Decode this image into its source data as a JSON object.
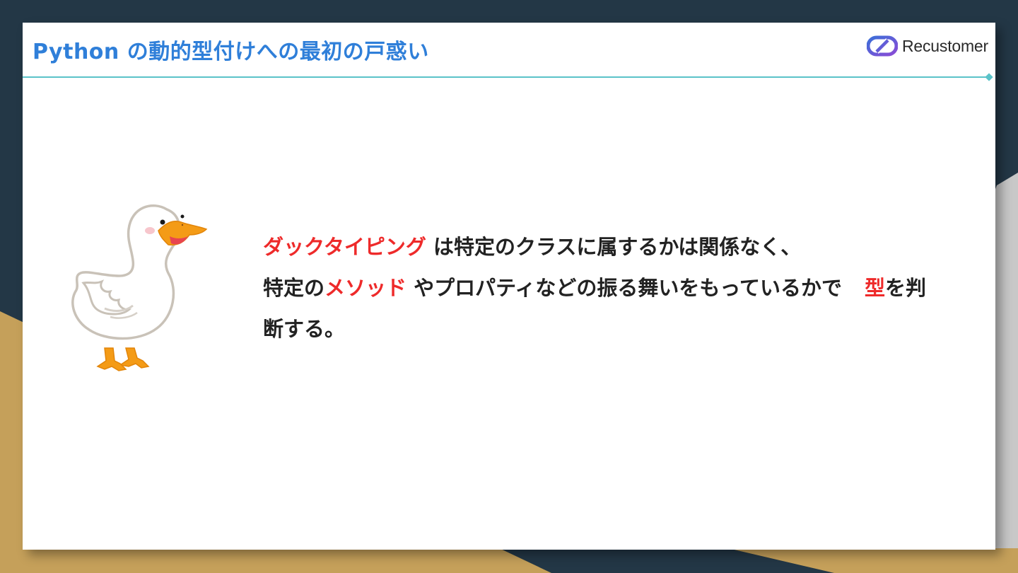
{
  "slide": {
    "title": "Python の動的型付けへの最初の戸惑い",
    "logo_text": "Recustomer"
  },
  "content": {
    "line1": {
      "term": "ダックタイピング",
      "rest": " は特定のクラスに属するかは関係なく、"
    },
    "line2": {
      "prefix": "特定の",
      "method": "メソッド",
      "middle": " やプロパティなどの振る舞いをもっているかで",
      "type_word": "型",
      "suffix": "を判"
    },
    "line3": {
      "text": "断する。"
    }
  },
  "illustration": {
    "icon": "duck-icon"
  },
  "colors": {
    "title": "#2f7fd9",
    "highlight": "#ee2a2a",
    "accent_line": "#5bc3c9",
    "background_dark": "#233746",
    "background_tan": "#c5a05a"
  }
}
